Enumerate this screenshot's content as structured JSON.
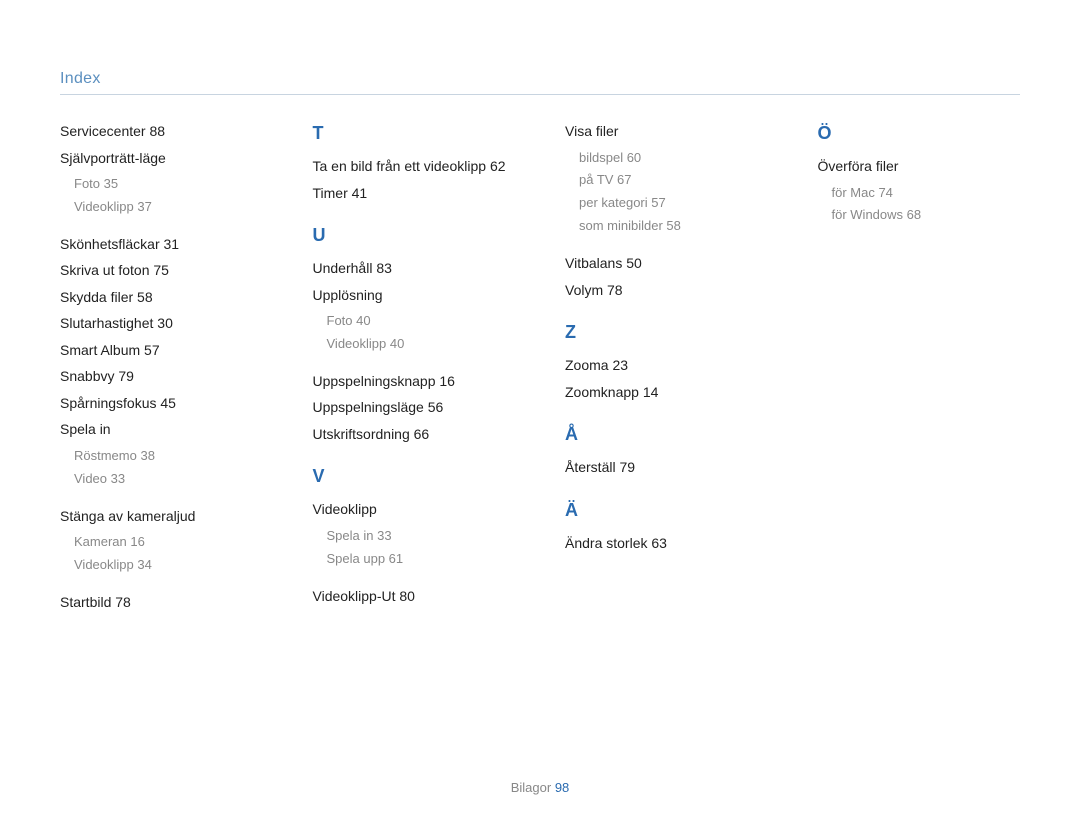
{
  "page_title": "Index",
  "footer": {
    "label": "Bilagor",
    "page": "98"
  },
  "columns": [
    {
      "items": [
        {
          "type": "entry",
          "text": "Servicecenter  88"
        },
        {
          "type": "entry",
          "text": "Självporträtt-läge"
        },
        {
          "type": "sub",
          "text": "Foto  35"
        },
        {
          "type": "sub",
          "text": "Videoklipp  37",
          "gap_after": true
        },
        {
          "type": "entry",
          "text": "Skönhetsfläckar  31"
        },
        {
          "type": "entry",
          "text": "Skriva ut foton  75"
        },
        {
          "type": "entry",
          "text": "Skydda filer  58"
        },
        {
          "type": "entry",
          "text": "Slutarhastighet  30"
        },
        {
          "type": "entry",
          "text": "Smart Album  57"
        },
        {
          "type": "entry",
          "text": "Snabbvy  79"
        },
        {
          "type": "entry",
          "text": "Spårningsfokus  45"
        },
        {
          "type": "entry",
          "text": "Spela in"
        },
        {
          "type": "sub",
          "text": "Röstmemo  38"
        },
        {
          "type": "sub",
          "text": "Video  33",
          "gap_after": true
        },
        {
          "type": "entry",
          "text": "Stänga av kameraljud"
        },
        {
          "type": "sub",
          "text": "Kameran  16"
        },
        {
          "type": "sub",
          "text": "Videoklipp  34",
          "gap_after": true
        },
        {
          "type": "entry",
          "text": "Startbild  78"
        }
      ]
    },
    {
      "items": [
        {
          "type": "letter",
          "text": "T",
          "first": true
        },
        {
          "type": "entry",
          "text": "Ta en bild från ett videoklipp  62"
        },
        {
          "type": "entry",
          "text": "Timer  41",
          "gap_after": true
        },
        {
          "type": "letter",
          "text": "U"
        },
        {
          "type": "entry",
          "text": "Underhåll  83"
        },
        {
          "type": "entry",
          "text": "Upplösning"
        },
        {
          "type": "sub",
          "text": "Foto  40"
        },
        {
          "type": "sub",
          "text": "Videoklipp  40",
          "gap_after": true
        },
        {
          "type": "entry",
          "text": "Uppspelningsknapp  16"
        },
        {
          "type": "entry",
          "text": "Uppspelningsläge  56"
        },
        {
          "type": "entry",
          "text": "Utskriftsordning  66",
          "gap_after": true
        },
        {
          "type": "letter",
          "text": "V"
        },
        {
          "type": "entry",
          "text": "Videoklipp"
        },
        {
          "type": "sub",
          "text": "Spela in  33"
        },
        {
          "type": "sub",
          "text": "Spela upp  61",
          "gap_after": true
        },
        {
          "type": "entry",
          "text": "Videoklipp-Ut  80"
        }
      ]
    },
    {
      "items": [
        {
          "type": "entry",
          "text": "Visa filer"
        },
        {
          "type": "sub",
          "text": "bildspel  60"
        },
        {
          "type": "sub",
          "text": "på TV  67"
        },
        {
          "type": "sub",
          "text": "per kategori  57"
        },
        {
          "type": "sub",
          "text": "som minibilder  58",
          "gap_after": true
        },
        {
          "type": "entry",
          "text": "Vitbalans  50"
        },
        {
          "type": "entry",
          "text": "Volym  78",
          "gap_after": true
        },
        {
          "type": "letter",
          "text": "Z"
        },
        {
          "type": "entry",
          "text": "Zooma  23"
        },
        {
          "type": "entry",
          "text": "Zoomknapp  14",
          "gap_after": true
        },
        {
          "type": "letter",
          "text": "Å"
        },
        {
          "type": "entry",
          "text": "Återställ  79",
          "gap_after": true
        },
        {
          "type": "letter",
          "text": "Ä"
        },
        {
          "type": "entry",
          "text": "Ändra storlek  63"
        }
      ]
    },
    {
      "items": [
        {
          "type": "letter",
          "text": "Ö",
          "first": true
        },
        {
          "type": "entry",
          "text": "Överföra filer"
        },
        {
          "type": "sub",
          "text": "för Mac  74"
        },
        {
          "type": "sub",
          "text": "för Windows  68"
        }
      ]
    }
  ]
}
